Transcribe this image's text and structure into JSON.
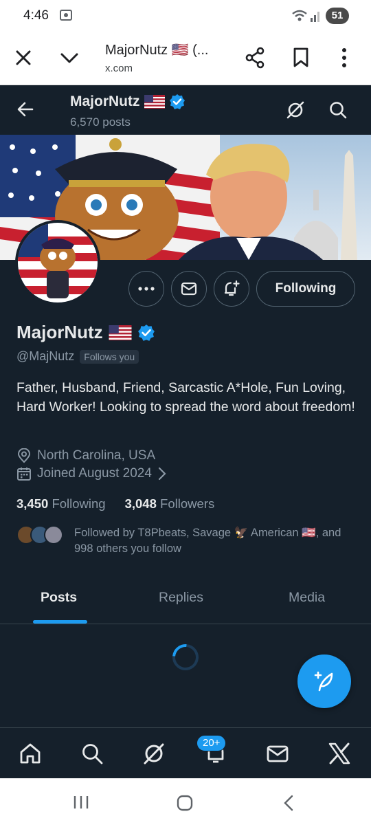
{
  "status_bar": {
    "time": "4:46",
    "battery": "51"
  },
  "browser": {
    "title": "MajorNutz 🇺🇸 (...",
    "url": "x.com"
  },
  "x_header": {
    "name": "MajorNutz",
    "posts_count": "6,570 posts"
  },
  "profile": {
    "name": "MajorNutz",
    "handle": "@MajNutz",
    "follows_you": "Follows you",
    "bio": "Father, Husband, Friend, Sarcastic A*Hole, Fun Loving, Hard Worker! Looking to spread the word about freedom!",
    "location": "North Carolina, USA",
    "joined": "Joined August 2024",
    "following_count": "3,450",
    "following_label": "Following",
    "followers_count": "3,048",
    "followers_label": "Followers",
    "followed_by": "Followed by T8Pbeats, Savage 🦅 American 🇺🇸, and 998 others you follow"
  },
  "actions": {
    "following_button": "Following"
  },
  "tabs": [
    {
      "label": "Posts",
      "active": true
    },
    {
      "label": "Replies",
      "active": false
    },
    {
      "label": "Media",
      "active": false
    }
  ],
  "bottom_nav": {
    "notifications_badge": "20+"
  },
  "colors": {
    "background": "#15202b",
    "accent": "#1d9bf0",
    "verified": "#1d9bf0",
    "muted_text": "#8b98a5"
  },
  "icons": [
    "close-icon",
    "chevron-down-icon",
    "share-icon",
    "bookmark-icon",
    "more-vert-icon",
    "back-arrow-icon",
    "grok-icon",
    "search-icon",
    "verified-badge-icon",
    "us-flag-icon",
    "more-horiz-icon",
    "mail-icon",
    "notify-plus-icon",
    "location-icon",
    "calendar-icon",
    "chevron-right-icon",
    "compose-icon",
    "home-icon",
    "bell-icon",
    "x-logo-icon"
  ]
}
